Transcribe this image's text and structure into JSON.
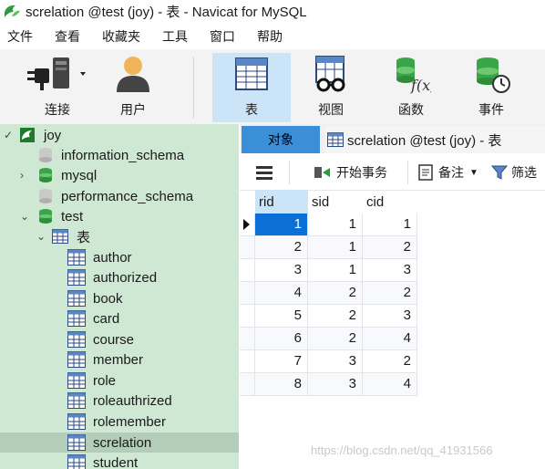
{
  "window": {
    "title": "screlation @test (joy) - 表 - Navicat for MySQL"
  },
  "menu": [
    "文件",
    "查看",
    "收藏夹",
    "工具",
    "窗口",
    "帮助"
  ],
  "toolbar": {
    "connect": "连接",
    "user": "用户",
    "table": "表",
    "view": "视图",
    "function": "函数",
    "event": "事件"
  },
  "tree": {
    "connection": "joy",
    "databases": [
      "information_schema",
      "mysql",
      "performance_schema",
      "test"
    ],
    "tables_group": "表",
    "tables": [
      "author",
      "authorized",
      "book",
      "card",
      "course",
      "member",
      "role",
      "roleauthrized",
      "rolemember",
      "screlation",
      "student"
    ],
    "selected": "screlation"
  },
  "tabs": {
    "objects": "对象",
    "table_tab": "screlation @test (joy) - 表"
  },
  "subtoolbar": {
    "begin_transaction": "开始事务",
    "note": "备注",
    "filter": "筛选"
  },
  "grid": {
    "columns": [
      "rid",
      "sid",
      "cid"
    ],
    "rows": [
      [
        "1",
        "1",
        "1"
      ],
      [
        "2",
        "1",
        "2"
      ],
      [
        "3",
        "1",
        "3"
      ],
      [
        "4",
        "2",
        "2"
      ],
      [
        "5",
        "2",
        "3"
      ],
      [
        "6",
        "2",
        "4"
      ],
      [
        "7",
        "3",
        "2"
      ],
      [
        "8",
        "3",
        "4"
      ]
    ]
  },
  "watermark": "https://blog.csdn.net/qq_41931566",
  "colors": {
    "sidebar_bg": "#cfe8d4",
    "tab_active": "#3b8fd9",
    "toolbar_active": "#cce4f7",
    "cell_selected": "#0a6fd6",
    "row_alt": "#f7f9fc"
  }
}
